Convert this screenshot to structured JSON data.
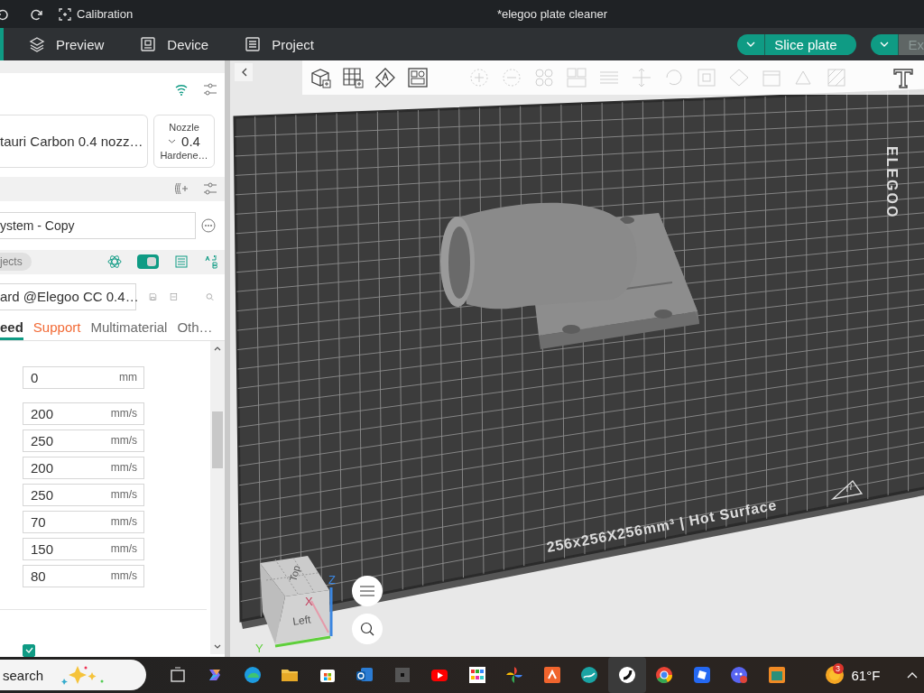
{
  "title_bar": {
    "calibration": "Calibration",
    "title": "*elegoo plate cleaner"
  },
  "main_tabs": [
    {
      "label": "Preview",
      "selected": false
    },
    {
      "label": "Device",
      "selected": false
    },
    {
      "label": "Project",
      "selected": false
    }
  ],
  "slice_button": {
    "label": "Slice plate",
    "disabled": false
  },
  "export_button": {
    "label": "Ex",
    "disabled": true
  },
  "printer": {
    "name": "tauri Carbon 0.4 nozz…",
    "nozzle_label": "Nozzle",
    "nozzle_size": "0.4",
    "nozzle_type": "Hardene…"
  },
  "filament_preset": "ystem - Copy",
  "objects_chip": "jects",
  "objects_toggle": {
    "on": true
  },
  "process_preset": "ard @Elegoo CC 0.4…",
  "setting_tabs": [
    {
      "label": "eed",
      "selected": true,
      "modified": false
    },
    {
      "label": "Support",
      "selected": false,
      "modified": true
    },
    {
      "label": "Multimaterial",
      "selected": false,
      "modified": false
    },
    {
      "label": "Oth…",
      "selected": false,
      "modified": false
    }
  ],
  "fields": [
    {
      "value": "0",
      "unit": "mm"
    },
    {
      "value": "200",
      "unit": "mm/s"
    },
    {
      "value": "250",
      "unit": "mm/s"
    },
    {
      "value": "200",
      "unit": "mm/s"
    },
    {
      "value": "250",
      "unit": "mm/s"
    },
    {
      "value": "70",
      "unit": "mm/s"
    },
    {
      "value": "150",
      "unit": "mm/s"
    },
    {
      "value": "80",
      "unit": "mm/s"
    }
  ],
  "option_checkbox": {
    "checked": true
  },
  "viewport": {
    "bed_label": "256x256X256mm³ | Hot Surface",
    "bed_brand": "ELEGOO",
    "cube_top": "Top",
    "cube_left": "Left",
    "axis_x": "X",
    "axis_y": "Y",
    "axis_z": "Z"
  },
  "taskbar": {
    "search": "search",
    "weather_badge": "3",
    "temperature": "61°F"
  }
}
